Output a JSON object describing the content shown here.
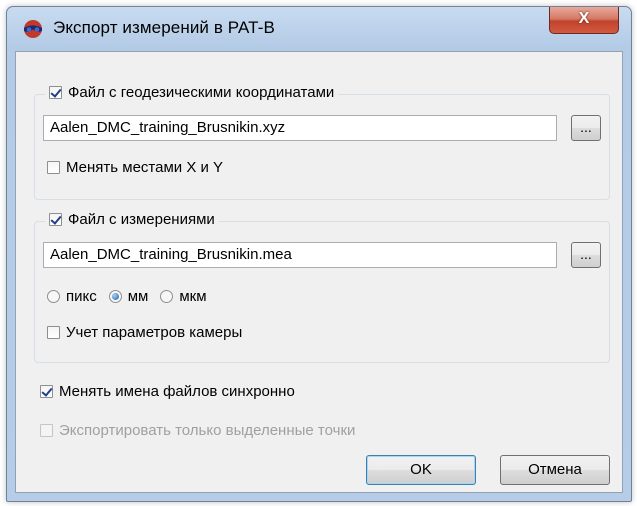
{
  "window": {
    "title": "Экспорт измерений в PAT-B",
    "close_label": "X"
  },
  "geo_group": {
    "checkbox_label": "Файл с геодезическими координатами",
    "checked": true,
    "file_value": "Aalen_DMC_training_Brusnikin.xyz",
    "browse_label": "...",
    "swap_label": "Менять местами X и Y",
    "swap_checked": false
  },
  "meas_group": {
    "checkbox_label": "Файл с измерениями",
    "checked": true,
    "file_value": "Aalen_DMC_training_Brusnikin.mea",
    "browse_label": "...",
    "units": [
      {
        "label": "пикс",
        "selected": false
      },
      {
        "label": "мм",
        "selected": true
      },
      {
        "label": "мкм",
        "selected": false
      }
    ],
    "camera_label": "Учет параметров камеры",
    "camera_checked": false
  },
  "sync_names": {
    "label": "Менять имена файлов синхронно",
    "checked": true
  },
  "selected_only": {
    "label": "Экспортировать только выделенные точки",
    "checked": false,
    "enabled": false
  },
  "buttons": {
    "ok": "OK",
    "cancel": "Отмена"
  }
}
